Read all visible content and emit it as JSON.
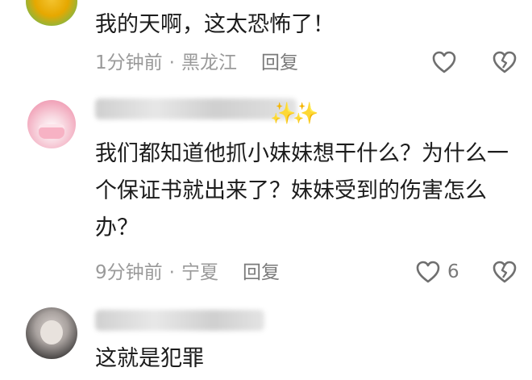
{
  "comments": [
    {
      "text": "我的天啊，这太恐怖了！",
      "time": "1分钟前",
      "location": "黑龙江",
      "reply_label": "回复"
    },
    {
      "text": "我们都知道他抓小妹妹想干什么？为什么一个保证书就出来了？妹妹受到的伤害怎么办？",
      "time": "9分钟前",
      "location": "宁夏",
      "reply_label": "回复",
      "likes": "6"
    },
    {
      "text": "这就是犯罪"
    }
  ],
  "separator": "·",
  "icons": {
    "like": "heart-outline-icon",
    "dislike": "broken-heart-icon"
  },
  "colors": {
    "text": "#1c1c1c",
    "meta": "#9a9a9a",
    "icon": "#6f6f6f"
  }
}
